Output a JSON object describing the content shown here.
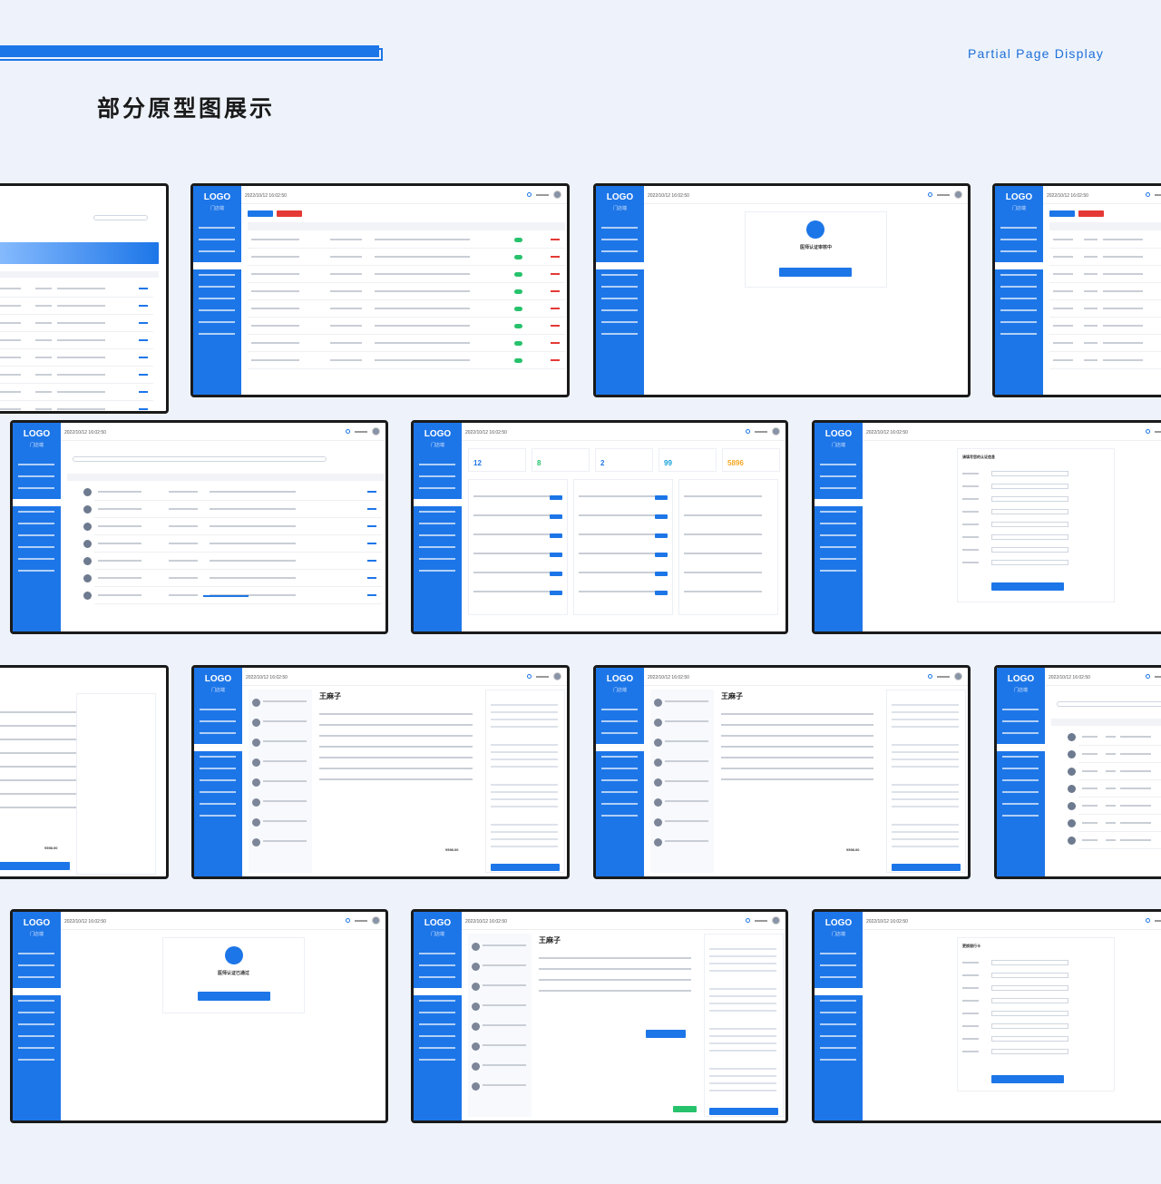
{
  "header": {
    "title": "部分原型图展示",
    "subtitle": "Partial Page Display"
  },
  "common": {
    "logo": "LOGO",
    "store": "门店端",
    "timestamp": "2022/10/12 16:02:50"
  },
  "stats": {
    "s1": "12",
    "s2": "8",
    "s3": "2",
    "s4": "99",
    "s5": "5896"
  },
  "forms": {
    "auth_title": "请填写您的认证信息",
    "bank_title": "更换银行卡",
    "auth_review": "医师认证审核中",
    "auth_pass": "医师认证已通过"
  },
  "patient": {
    "name": "王麻子",
    "price1": "¥598.00",
    "price2": "¥598.00",
    "price3": "¥598.00"
  },
  "colors": {
    "accent": "#1d76e8",
    "success": "#27c26c",
    "danger": "#e53935",
    "warning": "#f5a623"
  }
}
